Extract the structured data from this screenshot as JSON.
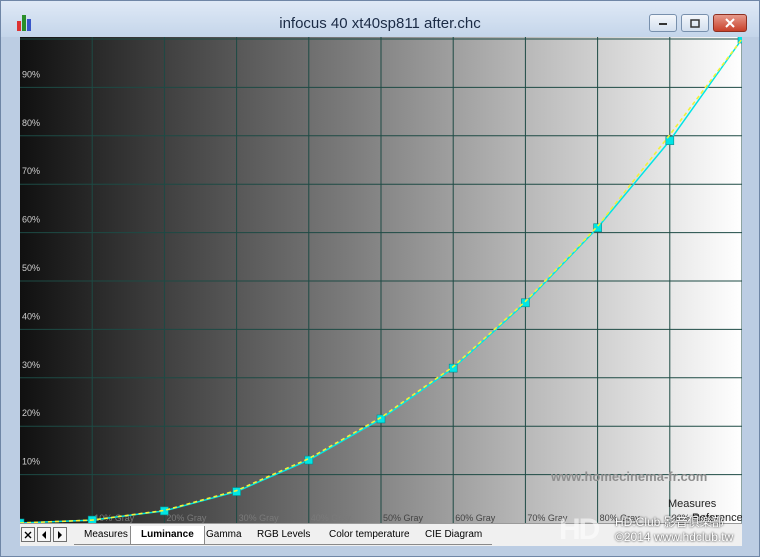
{
  "window": {
    "title": "infocus 40 xt40sp811 after.chc",
    "controls": [
      "minimize-icon",
      "maximize-icon",
      "close-icon"
    ]
  },
  "chart_data": {
    "type": "line",
    "ylim": [
      0,
      100
    ],
    "xlim": [
      0,
      100
    ],
    "y_tick_labels": [
      "10%",
      "20%",
      "30%",
      "40%",
      "50%",
      "60%",
      "70%",
      "80%",
      "90%"
    ],
    "x_tick_labels": [
      "10% Gray",
      "20% Gray",
      "30% Gray",
      "40% Gray",
      "50% Gray",
      "60% Gray",
      "70% Gray",
      "80% Gray",
      "90% Gray"
    ],
    "grid": true,
    "series": [
      {
        "color": "#00e5e5",
        "marker": "square",
        "x": [
          0,
          10,
          20,
          30,
          40,
          50,
          60,
          70,
          80,
          90,
          100
        ],
        "y": [
          0,
          0.6,
          2.5,
          6.5,
          13,
          21.5,
          32,
          45.5,
          61,
          79,
          100
        ]
      },
      {
        "color": "#f2f238",
        "style": "dashed",
        "x": [
          0,
          10,
          20,
          30,
          40,
          50,
          60,
          70,
          80,
          90,
          100
        ],
        "y": [
          0,
          0.6,
          2.6,
          6.7,
          13.3,
          21.8,
          32.3,
          45.8,
          61.3,
          80.2,
          100
        ]
      }
    ]
  },
  "tabs": [
    "Measures",
    "Luminance",
    "Gamma",
    "RGB Levels",
    "Color temperature",
    "CIE Diagram"
  ],
  "active_tab": "Luminance",
  "tab_nav": [
    "close-icon",
    "arrow-left-icon",
    "arrow-right-icon"
  ],
  "watermarks": {
    "site": "www.homecinema-fr.com",
    "brand": "HD.Club",
    "brand_cjk": "影音俱樂部",
    "copyright": "©2014 www.hdclub.tw",
    "legend_fragment": "Measures",
    "legend_fragment2": "Reference"
  },
  "colors": {
    "curve": "#00e5e5",
    "reference": "#f2f238",
    "grid": "#1d4a44"
  }
}
